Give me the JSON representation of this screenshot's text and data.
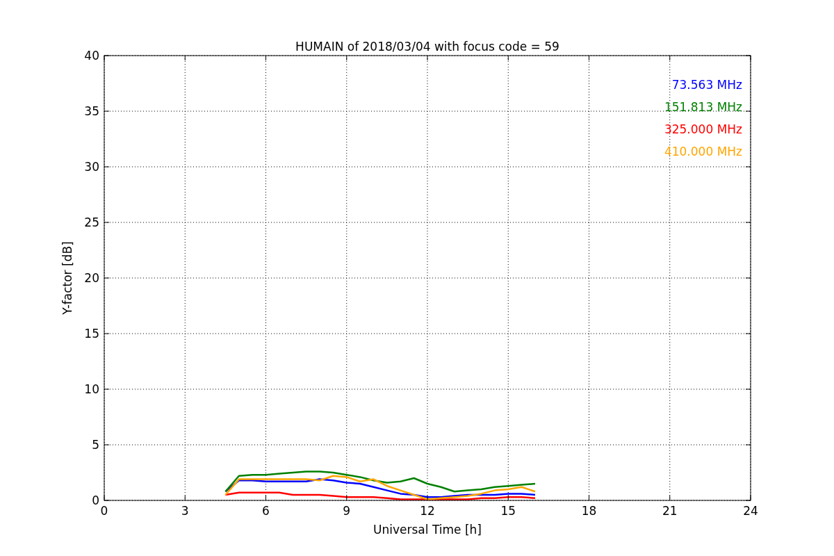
{
  "figure": {
    "chart_data": {
      "type": "line",
      "title": "HUMAIN of 2018/03/04 with focus code = 59",
      "xlabel": "Universal Time [h]",
      "ylabel": "Y-factor [dB]",
      "x": [
        4.5,
        5,
        5.5,
        6,
        6.5,
        7,
        7.5,
        8,
        8.5,
        9,
        9.5,
        10,
        10.5,
        11,
        11.5,
        12,
        12.5,
        13,
        13.5,
        14,
        14.5,
        15,
        15.5,
        16
      ],
      "series": [
        {
          "name": "73.563 MHz",
          "color": "#0000ff",
          "values": [
            0.8,
            1.8,
            1.8,
            1.7,
            1.7,
            1.7,
            1.7,
            1.9,
            1.8,
            1.6,
            1.5,
            1.2,
            0.9,
            0.6,
            0.5,
            0.3,
            0.3,
            0.4,
            0.5,
            0.5,
            0.5,
            0.6,
            0.6,
            0.5
          ]
        },
        {
          "name": "151.813 MHz",
          "color": "#008000",
          "values": [
            0.8,
            2.2,
            2.3,
            2.3,
            2.4,
            2.5,
            2.6,
            2.6,
            2.5,
            2.3,
            2.1,
            1.8,
            1.6,
            1.7,
            2.0,
            1.5,
            1.2,
            0.8,
            0.9,
            1.0,
            1.2,
            1.3,
            1.4,
            1.5
          ]
        },
        {
          "name": "325.000 MHz",
          "color": "#ff0000",
          "values": [
            0.5,
            0.7,
            0.7,
            0.7,
            0.7,
            0.5,
            0.5,
            0.5,
            0.4,
            0.3,
            0.3,
            0.3,
            0.2,
            0.1,
            0.1,
            0.1,
            0.1,
            0.1,
            0.1,
            0.2,
            0.2,
            0.3,
            0.3,
            0.2
          ]
        },
        {
          "name": "410.000 MHz",
          "color": "#ffa500",
          "values": [
            0.5,
            1.9,
            1.9,
            1.9,
            1.9,
            1.9,
            1.9,
            1.8,
            2.2,
            2.1,
            1.7,
            1.9,
            1.3,
            0.9,
            0.5,
            0.1,
            0.2,
            0.3,
            0.4,
            0.6,
            0.9,
            1.0,
            1.2,
            0.8
          ]
        }
      ],
      "xlim": [
        0,
        24
      ],
      "ylim": [
        0,
        40
      ],
      "xticks": [
        0,
        3,
        6,
        9,
        12,
        15,
        18,
        21,
        24
      ],
      "yticks": [
        0,
        5,
        10,
        15,
        20,
        25,
        30,
        35,
        40
      ],
      "grid": true
    }
  }
}
